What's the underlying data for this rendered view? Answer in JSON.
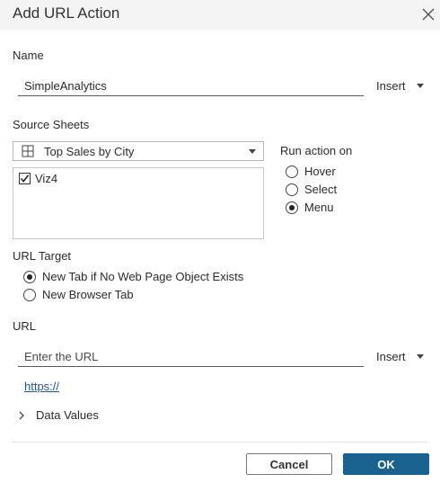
{
  "dialog": {
    "title": "Add URL Action",
    "close_icon": "close-icon"
  },
  "name_section": {
    "label": "Name",
    "value": "SimpleAnalytics",
    "insert_label": "Insert"
  },
  "source_sheets": {
    "label": "Source Sheets",
    "selected_source": "Top Sales by City",
    "sheets": [
      {
        "label": "Viz4",
        "checked": true
      }
    ]
  },
  "run_action_on": {
    "label": "Run action on",
    "options": [
      {
        "label": "Hover",
        "selected": false
      },
      {
        "label": "Select",
        "selected": false
      },
      {
        "label": "Menu",
        "selected": true
      }
    ]
  },
  "url_target": {
    "label": "URL Target",
    "options": [
      {
        "label": "New Tab if No Web Page Object Exists",
        "selected": true
      },
      {
        "label": "New Browser Tab",
        "selected": false
      }
    ]
  },
  "url_section": {
    "label": "URL",
    "placeholder": "Enter the URL",
    "value": "",
    "insert_label": "Insert",
    "link_text": "https://"
  },
  "data_values": {
    "label": "Data Values",
    "expanded": false
  },
  "buttons": {
    "cancel": "Cancel",
    "ok": "OK"
  },
  "colors": {
    "accent": "#1a628f",
    "link": "#1f5a8e",
    "titlebar": "#f4f4f4"
  }
}
